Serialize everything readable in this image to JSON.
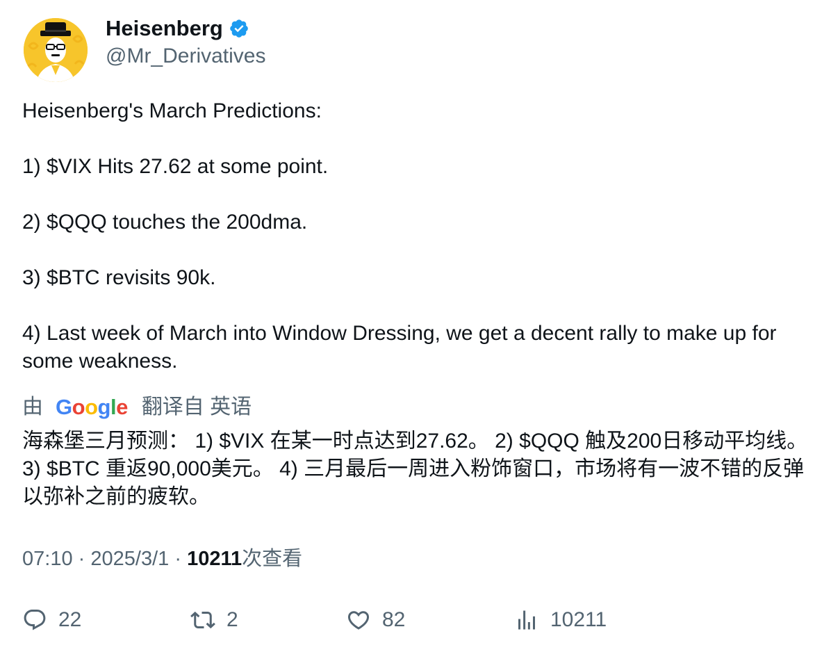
{
  "author": {
    "display_name": "Heisenberg",
    "handle": "@Mr_Derivatives",
    "avatar_icon": "heisenberg-avatar",
    "verified_icon": "verified-badge-icon",
    "verified_color": "#1d9bf0"
  },
  "tweet": {
    "lines": [
      "Heisenberg's March Predictions:",
      "1) $VIX Hits 27.62 at some point.",
      "2) $QQQ touches the 200dma.",
      "3) $BTC revisits 90k.",
      "4) Last week of March into Window Dressing, we get a decent rally to make up for some weakness."
    ]
  },
  "translation": {
    "prefix": "由",
    "google": {
      "G": "G",
      "o1": "o",
      "o2": "o",
      "g": "g",
      "l": "l",
      "e": "e"
    },
    "suffix": "翻译自 英语",
    "text": "海森堡三月预测： 1) $VIX 在某一时点达到27.62。 2) $QQQ 触及200日移动平均线。 3) $BTC 重返90,000美元。 4) 三月最后一周进入粉饰窗口，市场将有一波不错的反弹以弥补之前的疲软。"
  },
  "meta": {
    "time": "07:10",
    "separator": "·",
    "date": "2025/3/1",
    "views_count": "10211",
    "views_label": "次查看"
  },
  "actions": {
    "replies": {
      "icon": "reply-icon",
      "count": "22"
    },
    "retweets": {
      "icon": "retweet-icon",
      "count": "2"
    },
    "likes": {
      "icon": "like-icon",
      "count": "82"
    },
    "views": {
      "icon": "views-icon",
      "count": "10211"
    }
  },
  "colors": {
    "text_primary": "#0f1419",
    "text_secondary": "#536471",
    "avatar_bg": "#f7c52b"
  }
}
